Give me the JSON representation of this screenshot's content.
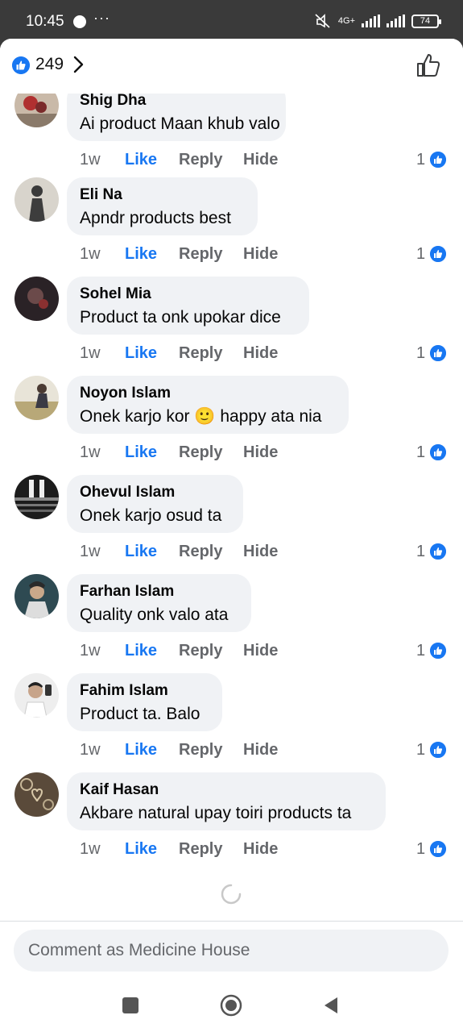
{
  "status_bar": {
    "time": "10:45",
    "dots": "···",
    "network": "4G+",
    "battery": "74"
  },
  "header": {
    "like_count": "249",
    "like_icon": "thumbs-up-icon",
    "chevron_icon": "chevron-right-icon",
    "like_button_icon": "thumbs-up-outline-icon"
  },
  "comments": [
    {
      "name": "Shig Dha",
      "text": "Ai product Maan khub valo",
      "time": "1w",
      "like": "Like",
      "reply": "Reply",
      "hide": "Hide",
      "reactions": "1"
    },
    {
      "name": "Eli Na",
      "text": "Apndr products best",
      "time": "1w",
      "like": "Like",
      "reply": "Reply",
      "hide": "Hide",
      "reactions": "1"
    },
    {
      "name": "Sohel Mia",
      "text": "Product ta onk upokar dice",
      "time": "1w",
      "like": "Like",
      "reply": "Reply",
      "hide": "Hide",
      "reactions": "1"
    },
    {
      "name": "Noyon Islam",
      "text": "Onek karjo kor 🙂 happy ata nia",
      "time": "1w",
      "like": "Like",
      "reply": "Reply",
      "hide": "Hide",
      "reactions": "1"
    },
    {
      "name": "Ohevul Islam",
      "text": "Onek karjo osud ta",
      "time": "1w",
      "like": "Like",
      "reply": "Reply",
      "hide": "Hide",
      "reactions": "1"
    },
    {
      "name": "Farhan Islam",
      "text": "Quality onk valo ata",
      "time": "1w",
      "like": "Like",
      "reply": "Reply",
      "hide": "Hide",
      "reactions": "1"
    },
    {
      "name": "Fahim Islam",
      "text": "Product ta. Balo",
      "time": "1w",
      "like": "Like",
      "reply": "Reply",
      "hide": "Hide",
      "reactions": "1"
    },
    {
      "name": "Kaif Hasan",
      "text": "Akbare natural upay toiri products ta",
      "time": "1w",
      "like": "Like",
      "reply": "Reply",
      "hide": "Hide",
      "reactions": "1"
    }
  ],
  "composer": {
    "placeholder": "Comment as Medicine House"
  },
  "colors": {
    "accent": "#1877f2",
    "bubble": "#f0f2f5",
    "muted": "#65676b"
  }
}
